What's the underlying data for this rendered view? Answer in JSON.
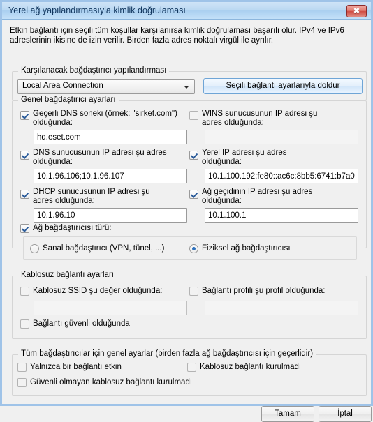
{
  "window": {
    "title": "Yerel ağ yapılandırmasıyla kimlik doğrulaması",
    "close_label": "✖",
    "intro": "Etkin bağlantı için seçili tüm koşullar karşılanırsa kimlik doğrulaması başarılı olur. IPv4 ve IPv6 adreslerinin ikisine de izin verilir. Birden fazla adres noktalı virgül ile ayrılır."
  },
  "adapter_config": {
    "legend": "Karşılanacak bağdaştırıcı yapılandırması",
    "combo_value": "Local Area Connection",
    "fill_button": "Seçili bağlantı ayarlarıyla doldur"
  },
  "general_adapter": {
    "legend": "Genel bağdaştırıcı ayarları",
    "dns_suffix": {
      "label": "Geçerli DNS soneki (örnek: \"sirket.com\")\nolduğunda:",
      "checked": true,
      "value": "hq.eset.com"
    },
    "wins_server": {
      "label": "WINS sunucusunun IP adresi şu\nadres olduğunda:",
      "checked": false,
      "value": ""
    },
    "dns_server": {
      "label": "DNS sunucusunun IP adresi şu adres\nolduğunda:",
      "checked": true,
      "value": "10.1.96.106;10.1.96.107"
    },
    "local_ip": {
      "label": "Yerel IP adresi şu adres\nolduğunda:",
      "checked": true,
      "value": "10.1.100.192;fe80::ac6c:8bb5:6741:b7a0"
    },
    "dhcp_server": {
      "label": "DHCP sunucusunun IP adresi şu\nadres olduğunda:",
      "checked": true,
      "value": "10.1.96.10"
    },
    "gateway_ip": {
      "label": "Ağ geçidinin IP adresi şu adres\nolduğunda:",
      "checked": true,
      "value": "10.1.100.1"
    },
    "adapter_type": {
      "label": "Ağ bağdaştırıcısı türü:",
      "checked": true,
      "options": [
        {
          "label": "Sanal bağdaştırıcı (VPN, tünel, ...)",
          "selected": false
        },
        {
          "label": "Fiziksel ağ bağdaştırıcısı",
          "selected": true
        }
      ]
    }
  },
  "wireless": {
    "legend": "Kablosuz bağlantı ayarları",
    "ssid": {
      "label": "Kablosuz SSID şu değer olduğunda:",
      "checked": false,
      "value": ""
    },
    "profile": {
      "label": "Bağlantı profili şu profil olduğunda:",
      "checked": false,
      "value": ""
    },
    "secure": {
      "label": "Bağlantı güvenli olduğunda",
      "checked": false
    }
  },
  "global": {
    "legend": "Tüm bağdaştırıcılar için genel ayarlar (birden fazla ağ bağdaştırıcısı için geçerlidir)",
    "only_one_active": {
      "label": "Yalnızca bir bağlantı etkin",
      "checked": false
    },
    "no_wireless": {
      "label": "Kablosuz bağlantı kurulmadı",
      "checked": false
    },
    "no_insecure_wireless": {
      "label": "Güvenli olmayan kablosuz bağlantı kurulmadı",
      "checked": false
    }
  },
  "footer": {
    "ok": "Tamam",
    "cancel": "İptal"
  }
}
